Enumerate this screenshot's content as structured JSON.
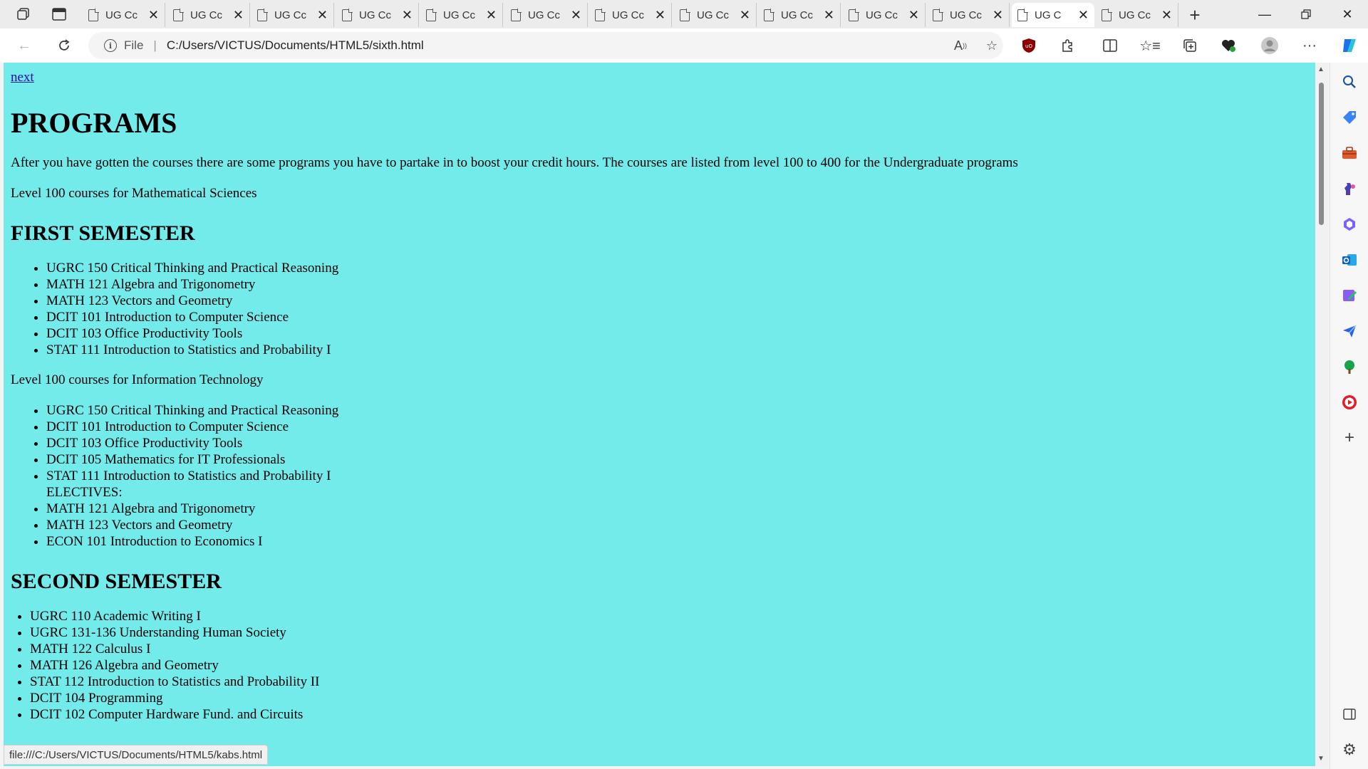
{
  "tabs": {
    "count": 13,
    "items": [
      {
        "title": "UG Cc"
      },
      {
        "title": "UG Cc"
      },
      {
        "title": "UG Cc"
      },
      {
        "title": "UG Cc"
      },
      {
        "title": "UG Cc"
      },
      {
        "title": "UG Cc"
      },
      {
        "title": "UG Cc"
      },
      {
        "title": "UG Cc"
      },
      {
        "title": "UG Cc"
      },
      {
        "title": "UG Cc"
      },
      {
        "title": "UG Cc"
      },
      {
        "title": "UG C"
      },
      {
        "title": "UG Cc"
      }
    ],
    "active_index": 11
  },
  "address_bar": {
    "scheme_label": "File",
    "url": "C:/Users/VICTUS/Documents/HTML5/sixth.html"
  },
  "page": {
    "background": "#73ebeb",
    "next_link": "next",
    "title": "PROGRAMS",
    "intro": "After you have gotten the courses there are some programs you have to partake in to boost your credit hours. The courses are listed from level 100 to 400 for the Undergraduate programs",
    "math_level": "Level 100 courses for Mathematical Sciences",
    "first_semester": "FIRST SEMESTER",
    "math_courses": [
      "UGRC 150 Critical Thinking and Practical Reasoning",
      "MATH 121 Algebra and Trigonometry",
      "MATH 123 Vectors and Geometry",
      "DCIT 101 Introduction to Computer Science",
      "DCIT 103 Office Productivity Tools",
      "STAT 111 Introduction to Statistics and Probability I"
    ],
    "it_level": "Level 100 courses for Information Technology",
    "it_courses": [
      "UGRC 150 Critical Thinking and Practical Reasoning",
      "DCIT 101 Introduction to Computer Science",
      "DCIT 103 Office Productivity Tools",
      "DCIT 105 Mathematics for IT Professionals",
      "STAT 111 Introduction to Statistics and Probability I"
    ],
    "electives_label": "ELECTIVES:",
    "electives": [
      "MATH 121 Algebra and Trigonometry",
      "MATH 123 Vectors and Geometry",
      "ECON 101 Introduction to Economics I"
    ],
    "second_semester": "SECOND SEMESTER",
    "second_courses": [
      "UGRC 110 Academic Writing I",
      "UGRC 131-136 Understanding Human Society",
      "MATH 122 Calculus I",
      "MATH 126 Algebra and Geometry",
      "STAT 112 Introduction to Statistics and Probability II",
      "DCIT 104 Programming",
      "DCIT 102 Computer Hardware Fund. and Circuits"
    ]
  },
  "status_bar": "file:///C:/Users/VICTUS/Documents/HTML5/kabs.html"
}
